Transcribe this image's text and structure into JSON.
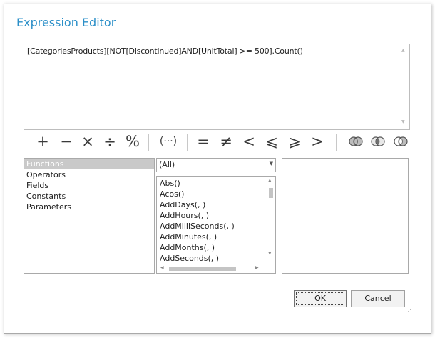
{
  "dialog": {
    "title": "Expression Editor",
    "expression": "[CategoriesProducts][NOT[Discontinued]AND[UnitTotal] >= 500].Count()"
  },
  "operators": [
    {
      "name": "plus",
      "symbol": "+"
    },
    {
      "name": "minus",
      "symbol": "−"
    },
    {
      "name": "multiply",
      "symbol": "×"
    },
    {
      "name": "divide",
      "symbol": "÷"
    },
    {
      "name": "modulo",
      "symbol": "%"
    },
    {
      "name": "parentheses",
      "symbol": "(···)"
    },
    {
      "name": "equal",
      "symbol": "="
    },
    {
      "name": "not-equal",
      "symbol": "≠"
    },
    {
      "name": "less",
      "symbol": "<"
    },
    {
      "name": "less-or-equal",
      "symbol": "⩽"
    },
    {
      "name": "greater-or-equal",
      "symbol": "⩾"
    },
    {
      "name": "greater",
      "symbol": ">"
    }
  ],
  "logical_icons": [
    "logical-or-icon",
    "logical-and-icon",
    "logical-not-icon"
  ],
  "categories": [
    "Functions",
    "Operators",
    "Fields",
    "Constants",
    "Parameters"
  ],
  "selected_category": "Functions",
  "filter": {
    "selected": "(All)"
  },
  "functions": [
    "Abs()",
    "Acos()",
    "AddDays(, )",
    "AddHours(, )",
    "AddMilliSeconds(, )",
    "AddMinutes(, )",
    "AddMonths(, )",
    "AddSeconds(, )"
  ],
  "buttons": {
    "ok": "OK",
    "cancel": "Cancel"
  },
  "colors": {
    "title": "#2b8fc8",
    "selection": "#c9c9c9"
  }
}
